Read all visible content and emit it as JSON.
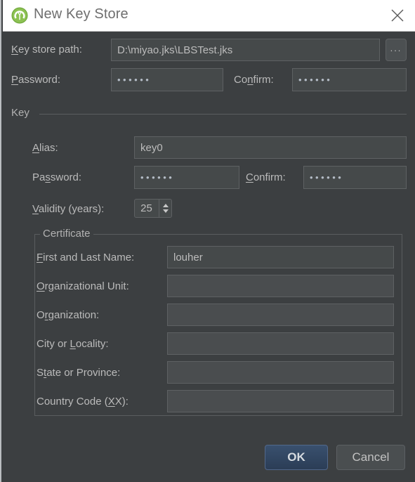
{
  "window": {
    "title": "New Key Store",
    "app_icon": "android-studio-icon",
    "close_icon": "close-icon"
  },
  "keystore": {
    "path_label": "Key store path:",
    "path_label_mnemonic": "K",
    "path_value": "D:\\miyao.jks\\LBSTest.jks",
    "browse_label": "...",
    "password_label": "Password:",
    "password_label_mnemonic": "P",
    "password_value": "••••••",
    "confirm_label": "Confirm:",
    "confirm_label_mnemonic": "n",
    "confirm_value": "••••••"
  },
  "key": {
    "group_label": "Key",
    "alias_label": "Alias:",
    "alias_label_mnemonic": "A",
    "alias_value": "key0",
    "password_label": "Password:",
    "password_label_mnemonic": "s",
    "password_value": "••••••",
    "confirm_label": "Confirm:",
    "confirm_label_mnemonic": "C",
    "confirm_value": "••••••",
    "validity_label": "Validity (years):",
    "validity_label_mnemonic": "V",
    "validity_value": "25"
  },
  "certificate": {
    "group_label": "Certificate",
    "fields": [
      {
        "label": "First and Last Name:",
        "mnemonic": "F",
        "value": "louher"
      },
      {
        "label": "Organizational Unit:",
        "mnemonic": "O",
        "value": ""
      },
      {
        "label": "Organization:",
        "mnemonic": "r",
        "value": ""
      },
      {
        "label": "City or Locality:",
        "mnemonic": "L",
        "value": ""
      },
      {
        "label": "State or Province:",
        "mnemonic": "t",
        "value": ""
      },
      {
        "label": "Country Code (XX):",
        "mnemonic": "X",
        "value": ""
      }
    ]
  },
  "footer": {
    "ok_label": "OK",
    "cancel_label": "Cancel"
  },
  "colors": {
    "dialog_background": "#3c3f41",
    "titlebar_background": "#ffffff",
    "field_background": "#45494a",
    "field_border": "#5e6163",
    "text": "#bbbbbb",
    "accent_ok": "#39506e",
    "icon_green": "#6ab344"
  }
}
